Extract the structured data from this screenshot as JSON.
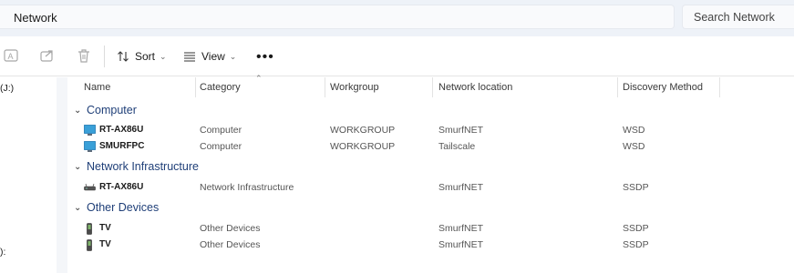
{
  "address_bar": {
    "location": "Network"
  },
  "search": {
    "placeholder": "Search Network"
  },
  "toolbar": {
    "sort_label": "Sort",
    "view_label": "View",
    "more_label": "•••"
  },
  "nav_pane": {
    "items": [
      {
        "label": "(J:)"
      },
      {
        "label": "):"
      }
    ]
  },
  "columns": [
    "Name",
    "Category",
    "Workgroup",
    "Network location",
    "Discovery Method"
  ],
  "groups": [
    {
      "label": "Computer",
      "items": [
        {
          "name": "RT-AX86U",
          "category": "Computer",
          "workgroup": "WORKGROUP",
          "location": "SmurfNET",
          "discovery": "WSD",
          "icon": "monitor-icon"
        },
        {
          "name": "SMURFPC",
          "category": "Computer",
          "workgroup": "WORKGROUP",
          "location": "Tailscale",
          "discovery": "WSD",
          "icon": "monitor-icon"
        }
      ]
    },
    {
      "label": "Network Infrastructure",
      "items": [
        {
          "name": "RT-AX86U",
          "category": "Network Infrastructure",
          "workgroup": "",
          "location": "SmurfNET",
          "discovery": "SSDP",
          "icon": "router-icon"
        }
      ]
    },
    {
      "label": "Other Devices",
      "items": [
        {
          "name": "TV",
          "category": "Other Devices",
          "workgroup": "",
          "location": "SmurfNET",
          "discovery": "SSDP",
          "icon": "device-icon"
        },
        {
          "name": "TV",
          "category": "Other Devices",
          "workgroup": "",
          "location": "SmurfNET",
          "discovery": "SSDP",
          "icon": "device-icon"
        }
      ]
    }
  ],
  "colors": {
    "group_heading": "#1f3f78",
    "monitor": "#3aa0d8",
    "topbar": "#eef2f8"
  }
}
